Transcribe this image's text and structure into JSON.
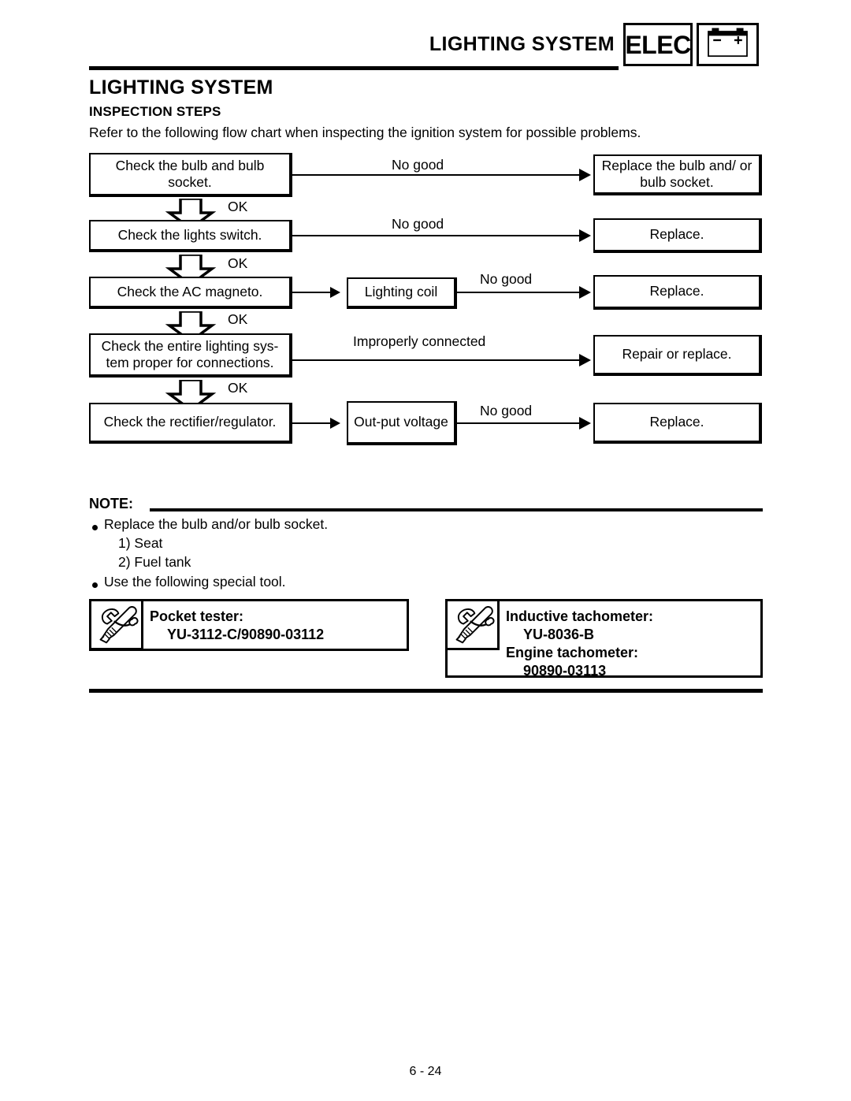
{
  "header": {
    "title": "LIGHTING SYSTEM",
    "elec_label": "ELEC",
    "battery_minus": "–",
    "battery_plus": "+"
  },
  "document": {
    "title": "LIGHTING SYSTEM",
    "subtitle": "INSPECTION STEPS",
    "intro": "Refer to the following flow chart when inspecting the ignition system for possible problems.",
    "page_number": "6 - 24"
  },
  "flowchart": {
    "ok_label": "OK",
    "steps": [
      {
        "check": "Check the bulb and bulb socket.",
        "condition": "No good",
        "action": "Replace the bulb and/ or bulb socket."
      },
      {
        "check": "Check the lights switch.",
        "condition": "No good",
        "action": "Replace."
      },
      {
        "check": "Check the AC magneto.",
        "intermediate": "Lighting coil",
        "condition": "No good",
        "action": "Replace."
      },
      {
        "check": "Check the entire lighting sys- tem proper for connections.",
        "condition": "Improperly connected",
        "action": "Repair or replace."
      },
      {
        "check": "Check the rectifier/regulator.",
        "intermediate": "Out-put voltage",
        "condition": "No good",
        "action": "Replace."
      }
    ]
  },
  "note": {
    "label": "NOTE:",
    "items": [
      "Replace the bulb and/or bulb socket.",
      "1)  Seat",
      "2)  Fuel tank",
      "Use the following special tool."
    ]
  },
  "tools": {
    "left": {
      "line1": "Pocket tester:",
      "line2": "YU-3112-C/90890-03112"
    },
    "right": {
      "line1": "Inductive tachometer:",
      "line2": "YU-8036-B",
      "line3": "Engine tachometer:",
      "line4": "90890-03113"
    }
  }
}
